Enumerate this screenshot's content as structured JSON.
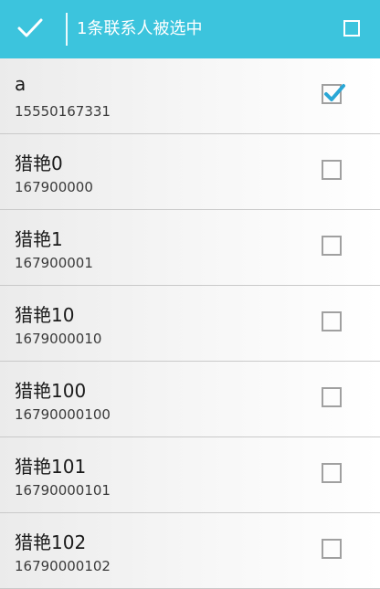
{
  "header": {
    "title": "1条联系人被选中",
    "done_icon": "check-icon",
    "select_all_checked": false
  },
  "colors": {
    "accent": "#3cc4dd",
    "check": "#2aa7d6"
  },
  "contacts": [
    {
      "name": "a",
      "phone": "15550167331",
      "checked": true
    },
    {
      "name": "猎艳0",
      "phone": "167900000",
      "checked": false
    },
    {
      "name": "猎艳1",
      "phone": "167900001",
      "checked": false
    },
    {
      "name": "猎艳10",
      "phone": "1679000010",
      "checked": false
    },
    {
      "name": "猎艳100",
      "phone": "16790000100",
      "checked": false
    },
    {
      "name": "猎艳101",
      "phone": "16790000101",
      "checked": false
    },
    {
      "name": "猎艳102",
      "phone": "16790000102",
      "checked": false
    }
  ]
}
